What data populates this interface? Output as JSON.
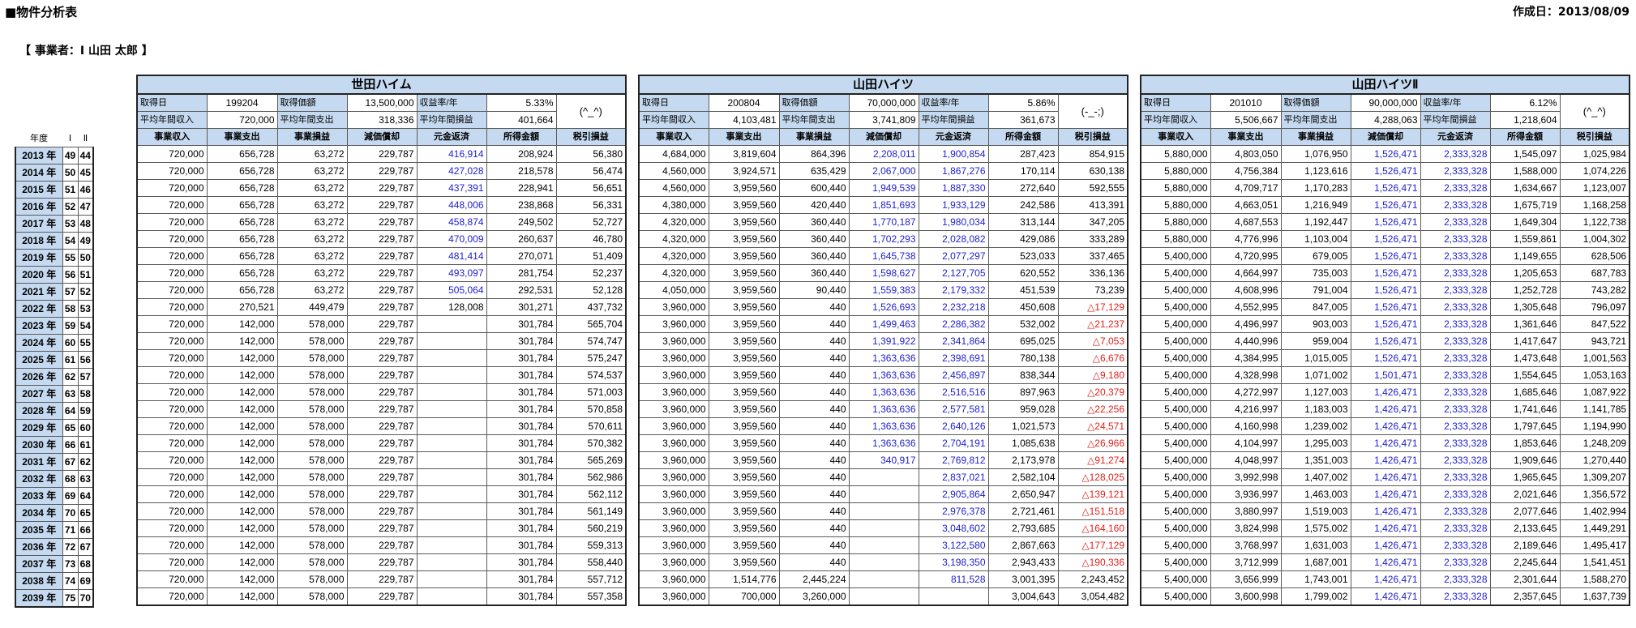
{
  "doc_title": "■物件分析表",
  "created": "作成日：2013/08/09",
  "owner": "【 事業者：I 山田  太郎 】",
  "year_table": {
    "h_year": "年度",
    "h_i": "Ⅰ",
    "h_ii": "Ⅱ",
    "rows": [
      [
        "2013 年",
        "49",
        "44"
      ],
      [
        "2014 年",
        "50",
        "45"
      ],
      [
        "2015 年",
        "51",
        "46"
      ],
      [
        "2016 年",
        "52",
        "47"
      ],
      [
        "2017 年",
        "53",
        "48"
      ],
      [
        "2018 年",
        "54",
        "49"
      ],
      [
        "2019 年",
        "55",
        "50"
      ],
      [
        "2020 年",
        "56",
        "51"
      ],
      [
        "2021 年",
        "57",
        "52"
      ],
      [
        "2022 年",
        "58",
        "53"
      ],
      [
        "2023 年",
        "59",
        "54"
      ],
      [
        "2024 年",
        "60",
        "55"
      ],
      [
        "2025 年",
        "61",
        "56"
      ],
      [
        "2026 年",
        "62",
        "57"
      ],
      [
        "2027 年",
        "63",
        "58"
      ],
      [
        "2028 年",
        "64",
        "59"
      ],
      [
        "2029 年",
        "65",
        "60"
      ],
      [
        "2030 年",
        "66",
        "61"
      ],
      [
        "2031 年",
        "67",
        "62"
      ],
      [
        "2032 年",
        "68",
        "63"
      ],
      [
        "2033 年",
        "69",
        "64"
      ],
      [
        "2034 年",
        "70",
        "65"
      ],
      [
        "2035 年",
        "71",
        "66"
      ],
      [
        "2036 年",
        "72",
        "67"
      ],
      [
        "2037 年",
        "73",
        "68"
      ],
      [
        "2038 年",
        "74",
        "69"
      ],
      [
        "2039 年",
        "75",
        "70"
      ]
    ]
  },
  "labels": {
    "acq_date": "取得日",
    "acq_price": "取得価額",
    "yield": "収益率/年",
    "avg_income": "平均年間収入",
    "avg_expense": "平均年間支出",
    "avg_profit": "平均年間損益",
    "cols": [
      "事業収入",
      "事業支出",
      "事業損益",
      "減価償却",
      "元金返済",
      "所得金額",
      "税引損益"
    ]
  },
  "properties": [
    {
      "name": "世田ハイム",
      "acq_date": "199204",
      "acq_price": "13,500,000",
      "yield": "5.33%",
      "avg_income": "720,000",
      "avg_expense": "318,336",
      "avg_profit": "401,664",
      "face": "(^_^)",
      "rows": [
        [
          "720,000",
          "656,728",
          "63,272",
          "229,787",
          "416,914",
          "208,924",
          "56,380"
        ],
        [
          "720,000",
          "656,728",
          "63,272",
          "229,787",
          "427,028",
          "218,578",
          "56,474"
        ],
        [
          "720,000",
          "656,728",
          "63,272",
          "229,787",
          "437,391",
          "228,941",
          "56,651"
        ],
        [
          "720,000",
          "656,728",
          "63,272",
          "229,787",
          "448,006",
          "238,868",
          "56,331"
        ],
        [
          "720,000",
          "656,728",
          "63,272",
          "229,787",
          "458,874",
          "249,502",
          "52,727"
        ],
        [
          "720,000",
          "656,728",
          "63,272",
          "229,787",
          "470,009",
          "260,637",
          "46,780"
        ],
        [
          "720,000",
          "656,728",
          "63,272",
          "229,787",
          "481,414",
          "270,071",
          "51,409"
        ],
        [
          "720,000",
          "656,728",
          "63,272",
          "229,787",
          "493,097",
          "281,754",
          "52,237"
        ],
        [
          "720,000",
          "656,728",
          "63,272",
          "229,787",
          "505,064",
          "292,531",
          "52,128"
        ],
        [
          "720,000",
          "270,521",
          "449,479",
          "229,787",
          "128,008",
          "301,271",
          "437,732"
        ],
        [
          "720,000",
          "142,000",
          "578,000",
          "229,787",
          "",
          "301,784",
          "565,704"
        ],
        [
          "720,000",
          "142,000",
          "578,000",
          "229,787",
          "",
          "301,784",
          "574,747"
        ],
        [
          "720,000",
          "142,000",
          "578,000",
          "229,787",
          "",
          "301,784",
          "575,247"
        ],
        [
          "720,000",
          "142,000",
          "578,000",
          "229,787",
          "",
          "301,784",
          "574,537"
        ],
        [
          "720,000",
          "142,000",
          "578,000",
          "229,787",
          "",
          "301,784",
          "571,003"
        ],
        [
          "720,000",
          "142,000",
          "578,000",
          "229,787",
          "",
          "301,784",
          "570,858"
        ],
        [
          "720,000",
          "142,000",
          "578,000",
          "229,787",
          "",
          "301,784",
          "570,611"
        ],
        [
          "720,000",
          "142,000",
          "578,000",
          "229,787",
          "",
          "301,784",
          "570,382"
        ],
        [
          "720,000",
          "142,000",
          "578,000",
          "229,787",
          "",
          "301,784",
          "565,269"
        ],
        [
          "720,000",
          "142,000",
          "578,000",
          "229,787",
          "",
          "301,784",
          "562,986"
        ],
        [
          "720,000",
          "142,000",
          "578,000",
          "229,787",
          "",
          "301,784",
          "562,112"
        ],
        [
          "720,000",
          "142,000",
          "578,000",
          "229,787",
          "",
          "301,784",
          "561,149"
        ],
        [
          "720,000",
          "142,000",
          "578,000",
          "229,787",
          "",
          "301,784",
          "560,219"
        ],
        [
          "720,000",
          "142,000",
          "578,000",
          "229,787",
          "",
          "301,784",
          "559,313"
        ],
        [
          "720,000",
          "142,000",
          "578,000",
          "229,787",
          "",
          "301,784",
          "558,440"
        ],
        [
          "720,000",
          "142,000",
          "578,000",
          "229,787",
          "",
          "301,784",
          "557,712"
        ],
        [
          "720,000",
          "142,000",
          "578,000",
          "229,787",
          "",
          "301,784",
          "557,358"
        ]
      ],
      "blue_cols": [
        [
          4,
          0,
          8
        ]
      ]
    },
    {
      "name": "山田ハイツ",
      "acq_date": "200804",
      "acq_price": "70,000,000",
      "yield": "5.86%",
      "avg_income": "4,103,481",
      "avg_expense": "3,741,809",
      "avg_profit": "361,673",
      "face": "(-_-;)",
      "rows": [
        [
          "4,684,000",
          "3,819,604",
          "864,396",
          "2,208,011",
          "1,900,854",
          "287,423",
          "854,915"
        ],
        [
          "4,560,000",
          "3,924,571",
          "635,429",
          "2,067,000",
          "1,867,276",
          "170,114",
          "630,138"
        ],
        [
          "4,560,000",
          "3,959,560",
          "600,440",
          "1,949,539",
          "1,887,330",
          "272,640",
          "592,555"
        ],
        [
          "4,380,000",
          "3,959,560",
          "420,440",
          "1,851,693",
          "1,933,129",
          "242,586",
          "413,391"
        ],
        [
          "4,320,000",
          "3,959,560",
          "360,440",
          "1,770,187",
          "1,980,034",
          "313,144",
          "347,205"
        ],
        [
          "4,320,000",
          "3,959,560",
          "360,440",
          "1,702,293",
          "2,028,082",
          "429,086",
          "333,289"
        ],
        [
          "4,320,000",
          "3,959,560",
          "360,440",
          "1,645,738",
          "2,077,297",
          "523,033",
          "337,465"
        ],
        [
          "4,320,000",
          "3,959,560",
          "360,440",
          "1,598,627",
          "2,127,705",
          "620,552",
          "336,136"
        ],
        [
          "4,050,000",
          "3,959,560",
          "90,440",
          "1,559,383",
          "2,179,332",
          "451,539",
          "73,239"
        ],
        [
          "3,960,000",
          "3,959,560",
          "440",
          "1,526,693",
          "2,232,218",
          "450,608",
          "△17,129"
        ],
        [
          "3,960,000",
          "3,959,560",
          "440",
          "1,499,463",
          "2,286,382",
          "532,002",
          "△21,237"
        ],
        [
          "3,960,000",
          "3,959,560",
          "440",
          "1,391,922",
          "2,341,864",
          "695,025",
          "△7,053"
        ],
        [
          "3,960,000",
          "3,959,560",
          "440",
          "1,363,636",
          "2,398,691",
          "780,138",
          "△6,676"
        ],
        [
          "3,960,000",
          "3,959,560",
          "440",
          "1,363,636",
          "2,456,897",
          "838,344",
          "△9,180"
        ],
        [
          "3,960,000",
          "3,959,560",
          "440",
          "1,363,636",
          "2,516,516",
          "897,963",
          "△20,379"
        ],
        [
          "3,960,000",
          "3,959,560",
          "440",
          "1,363,636",
          "2,577,581",
          "959,028",
          "△22,256"
        ],
        [
          "3,960,000",
          "3,959,560",
          "440",
          "1,363,636",
          "2,640,126",
          "1,021,573",
          "△24,571"
        ],
        [
          "3,960,000",
          "3,959,560",
          "440",
          "1,363,636",
          "2,704,191",
          "1,085,638",
          "△26,966"
        ],
        [
          "3,960,000",
          "3,959,560",
          "440",
          "340,917",
          "2,769,812",
          "2,173,978",
          "△91,274"
        ],
        [
          "3,960,000",
          "3,959,560",
          "440",
          "",
          "2,837,021",
          "2,582,104",
          "△128,025"
        ],
        [
          "3,960,000",
          "3,959,560",
          "440",
          "",
          "2,905,864",
          "2,650,947",
          "△139,121"
        ],
        [
          "3,960,000",
          "3,959,560",
          "440",
          "",
          "2,976,378",
          "2,721,461",
          "△151,518"
        ],
        [
          "3,960,000",
          "3,959,560",
          "440",
          "",
          "3,048,602",
          "2,793,685",
          "△164,160"
        ],
        [
          "3,960,000",
          "3,959,560",
          "440",
          "",
          "3,122,580",
          "2,867,663",
          "△177,129"
        ],
        [
          "3,960,000",
          "3,959,560",
          "440",
          "",
          "3,198,350",
          "2,943,433",
          "△190,336"
        ],
        [
          "3,960,000",
          "1,514,776",
          "2,445,224",
          "",
          "811,528",
          "3,001,395",
          "2,243,452"
        ],
        [
          "3,960,000",
          "700,000",
          "3,260,000",
          "",
          "",
          "3,004,643",
          "3,054,482"
        ]
      ]
    },
    {
      "name": "山田ハイツⅡ",
      "acq_date": "201010",
      "acq_price": "90,000,000",
      "yield": "6.12%",
      "avg_income": "5,506,667",
      "avg_expense": "4,288,063",
      "avg_profit": "1,218,604",
      "face": "(^_^)",
      "rows": [
        [
          "5,880,000",
          "4,803,050",
          "1,076,950",
          "1,526,471",
          "2,333,328",
          "1,545,097",
          "1,025,984"
        ],
        [
          "5,880,000",
          "4,756,384",
          "1,123,616",
          "1,526,471",
          "2,333,328",
          "1,588,000",
          "1,074,226"
        ],
        [
          "5,880,000",
          "4,709,717",
          "1,170,283",
          "1,526,471",
          "2,333,328",
          "1,634,667",
          "1,123,007"
        ],
        [
          "5,880,000",
          "4,663,051",
          "1,216,949",
          "1,526,471",
          "2,333,328",
          "1,675,719",
          "1,168,258"
        ],
        [
          "5,880,000",
          "4,687,553",
          "1,192,447",
          "1,526,471",
          "2,333,328",
          "1,649,304",
          "1,122,738"
        ],
        [
          "5,880,000",
          "4,776,996",
          "1,103,004",
          "1,526,471",
          "2,333,328",
          "1,559,861",
          "1,004,302"
        ],
        [
          "5,400,000",
          "4,720,995",
          "679,005",
          "1,526,471",
          "2,333,328",
          "1,149,655",
          "628,506"
        ],
        [
          "5,400,000",
          "4,664,997",
          "735,003",
          "1,526,471",
          "2,333,328",
          "1,205,653",
          "687,783"
        ],
        [
          "5,400,000",
          "4,608,996",
          "791,004",
          "1,526,471",
          "2,333,328",
          "1,252,728",
          "743,282"
        ],
        [
          "5,400,000",
          "4,552,995",
          "847,005",
          "1,526,471",
          "2,333,328",
          "1,305,648",
          "796,097"
        ],
        [
          "5,400,000",
          "4,496,997",
          "903,003",
          "1,526,471",
          "2,333,328",
          "1,361,646",
          "847,522"
        ],
        [
          "5,400,000",
          "4,440,996",
          "959,004",
          "1,526,471",
          "2,333,328",
          "1,417,647",
          "943,721"
        ],
        [
          "5,400,000",
          "4,384,995",
          "1,015,005",
          "1,526,471",
          "2,333,328",
          "1,473,648",
          "1,001,563"
        ],
        [
          "5,400,000",
          "4,328,998",
          "1,071,002",
          "1,501,471",
          "2,333,328",
          "1,554,645",
          "1,053,163"
        ],
        [
          "5,400,000",
          "4,272,997",
          "1,127,003",
          "1,426,471",
          "2,333,328",
          "1,685,646",
          "1,087,922"
        ],
        [
          "5,400,000",
          "4,216,997",
          "1,183,003",
          "1,426,471",
          "2,333,328",
          "1,741,646",
          "1,141,785"
        ],
        [
          "5,400,000",
          "4,160,998",
          "1,239,002",
          "1,426,471",
          "2,333,328",
          "1,797,645",
          "1,194,990"
        ],
        [
          "5,400,000",
          "4,104,997",
          "1,295,003",
          "1,426,471",
          "2,333,328",
          "1,853,646",
          "1,248,209"
        ],
        [
          "5,400,000",
          "4,048,997",
          "1,351,003",
          "1,426,471",
          "2,333,328",
          "1,909,646",
          "1,270,440"
        ],
        [
          "5,400,000",
          "3,992,998",
          "1,407,002",
          "1,426,471",
          "2,333,328",
          "1,965,645",
          "1,309,207"
        ],
        [
          "5,400,000",
          "3,936,997",
          "1,463,003",
          "1,426,471",
          "2,333,328",
          "2,021,646",
          "1,356,572"
        ],
        [
          "5,400,000",
          "3,880,997",
          "1,519,003",
          "1,426,471",
          "2,333,328",
          "2,077,646",
          "1,402,994"
        ],
        [
          "5,400,000",
          "3,824,998",
          "1,575,002",
          "1,426,471",
          "2,333,328",
          "2,133,645",
          "1,449,291"
        ],
        [
          "5,400,000",
          "3,768,997",
          "1,631,003",
          "1,426,471",
          "2,333,328",
          "2,189,646",
          "1,495,417"
        ],
        [
          "5,400,000",
          "3,712,999",
          "1,687,001",
          "1,426,471",
          "2,333,328",
          "2,245,644",
          "1,541,451"
        ],
        [
          "5,400,000",
          "3,656,999",
          "1,743,001",
          "1,426,471",
          "2,333,328",
          "2,301,644",
          "1,588,270"
        ],
        [
          "5,400,000",
          "3,600,998",
          "1,799,002",
          "1,426,471",
          "2,333,328",
          "2,357,645",
          "1,637,739"
        ]
      ]
    }
  ],
  "colors": {
    "header_bg": "#c5daf0",
    "blue_text": "#2020d0",
    "negative_text": "#e0201c"
  }
}
